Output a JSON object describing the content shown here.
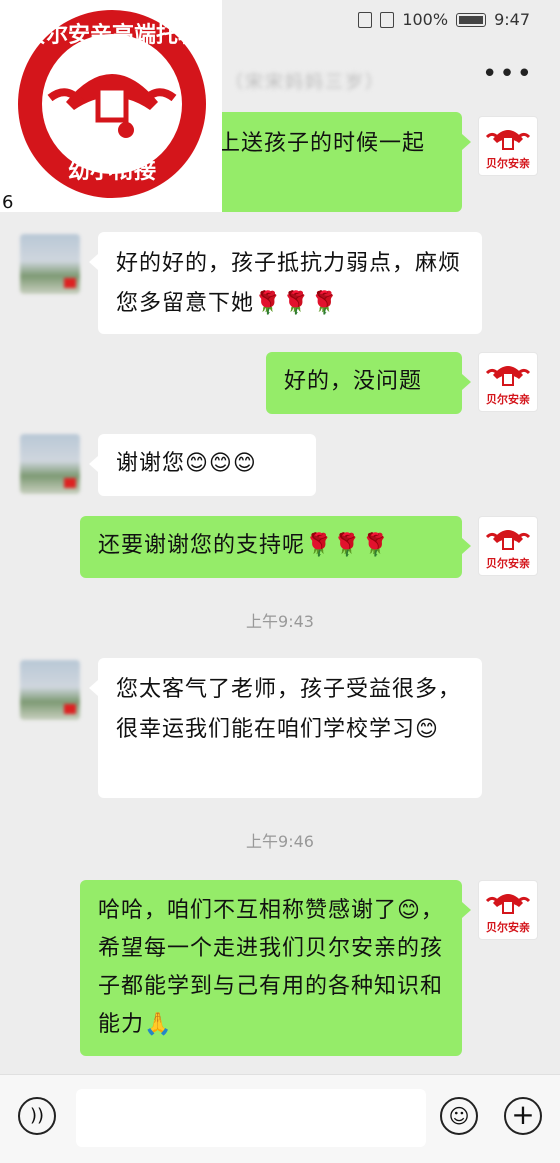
{
  "status_bar": {
    "battery": "100%",
    "time": "9:47"
  },
  "header": {
    "chat_title": "（宋宋妈妈三岁）",
    "more_icon": "more-dots-icon"
  },
  "logo_overlay": {
    "seal_text_top": "贝尔安亲高端托辅",
    "seal_text_bottom": "幼小衔接",
    "number": "6",
    "brand_color": "#d4151b"
  },
  "self_avatar_text": "贝尔安亲",
  "messages": [
    {
      "sender": "self",
      "text": "上送孩子的时候一起"
    },
    {
      "sender": "other",
      "text": "好的好的，孩子抵抗力弱点，麻烦您多留意下她🌹🌹🌹"
    },
    {
      "sender": "self",
      "text": "好的，没问题"
    },
    {
      "sender": "other",
      "text": "谢谢您😊😊😊"
    },
    {
      "sender": "self",
      "text": "还要谢谢您的支持呢🌹🌹🌹"
    },
    {
      "sender": "other",
      "text": "您太客气了老师，孩子受益很多，很幸运我们能在咱们学校学习😊"
    },
    {
      "sender": "self",
      "text": "哈哈，咱们不互相称赞感谢了😊，希望每一个走进我们贝尔安亲的孩子都能学到与己有用的各种知识和能力🙏"
    }
  ],
  "timestamps": [
    "上午9:43",
    "上午9:46"
  ],
  "input_bar": {
    "voice_icon": "voice-icon",
    "emoji_icon": "emoji-icon",
    "plus_icon": "plus-icon"
  },
  "colors": {
    "self_bubble": "#95ec69",
    "other_bubble": "#ffffff",
    "background": "#ededed"
  }
}
